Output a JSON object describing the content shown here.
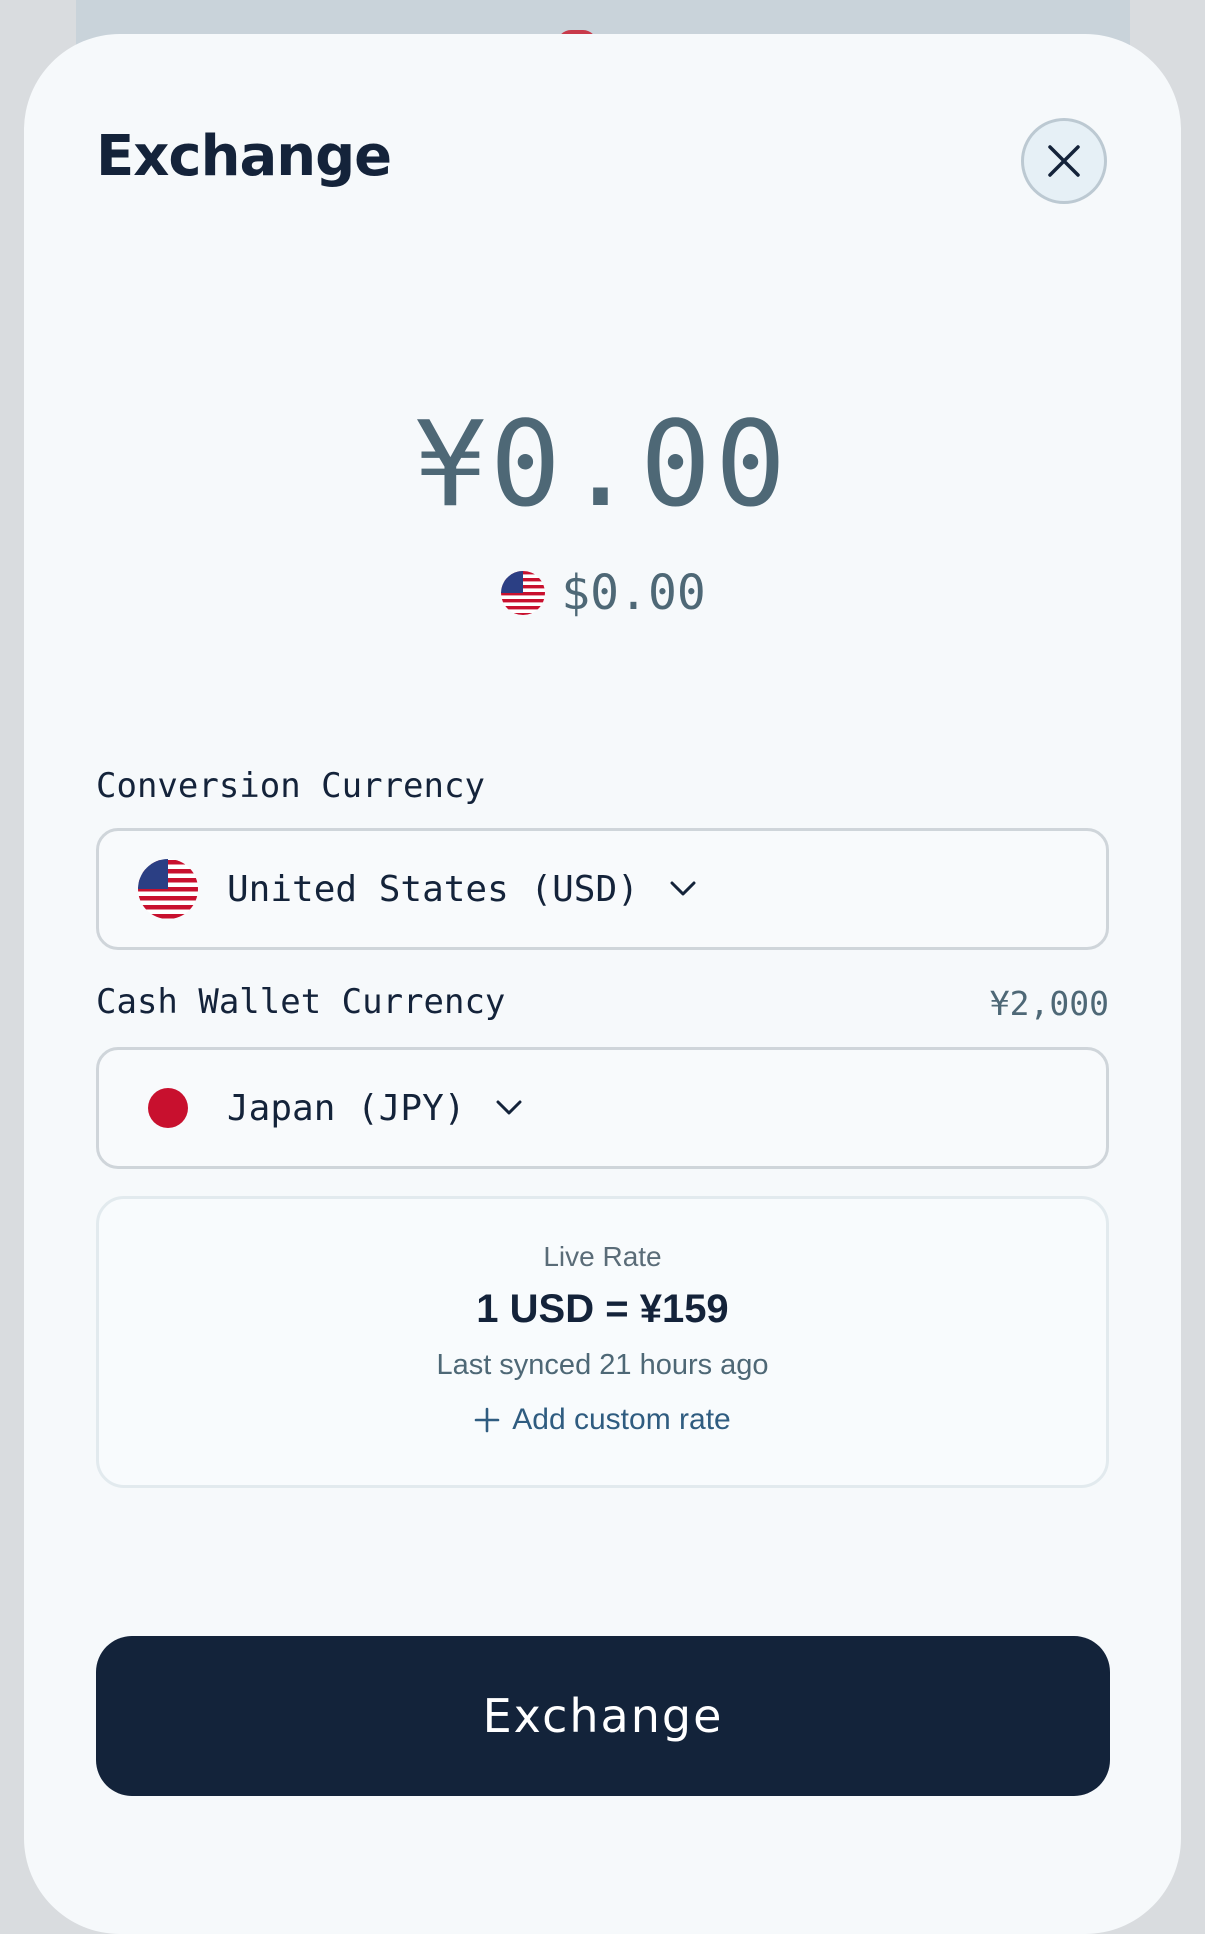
{
  "sheet": {
    "title": "Exchange",
    "close_icon": "close-icon"
  },
  "amount": {
    "primary": "¥0.00",
    "secondary": "$0.00",
    "secondary_flag": "us-flag-icon"
  },
  "conversion": {
    "label": "Conversion Currency",
    "selected": "United States (USD)",
    "flag": "us-flag-icon"
  },
  "wallet": {
    "label": "Cash Wallet Currency",
    "balance": "¥2,000",
    "selected": "Japan (JPY)",
    "flag": "jp-flag-icon"
  },
  "rate": {
    "label": "Live Rate",
    "value": "1 USD = ¥159",
    "synced": "Last synced 21 hours ago",
    "custom_label": "Add custom rate"
  },
  "actions": {
    "exchange_label": "Exchange"
  },
  "colors": {
    "primary": "#13233a",
    "muted": "#4e6876",
    "link": "#2f5c80",
    "jp_red": "#c8102e"
  }
}
